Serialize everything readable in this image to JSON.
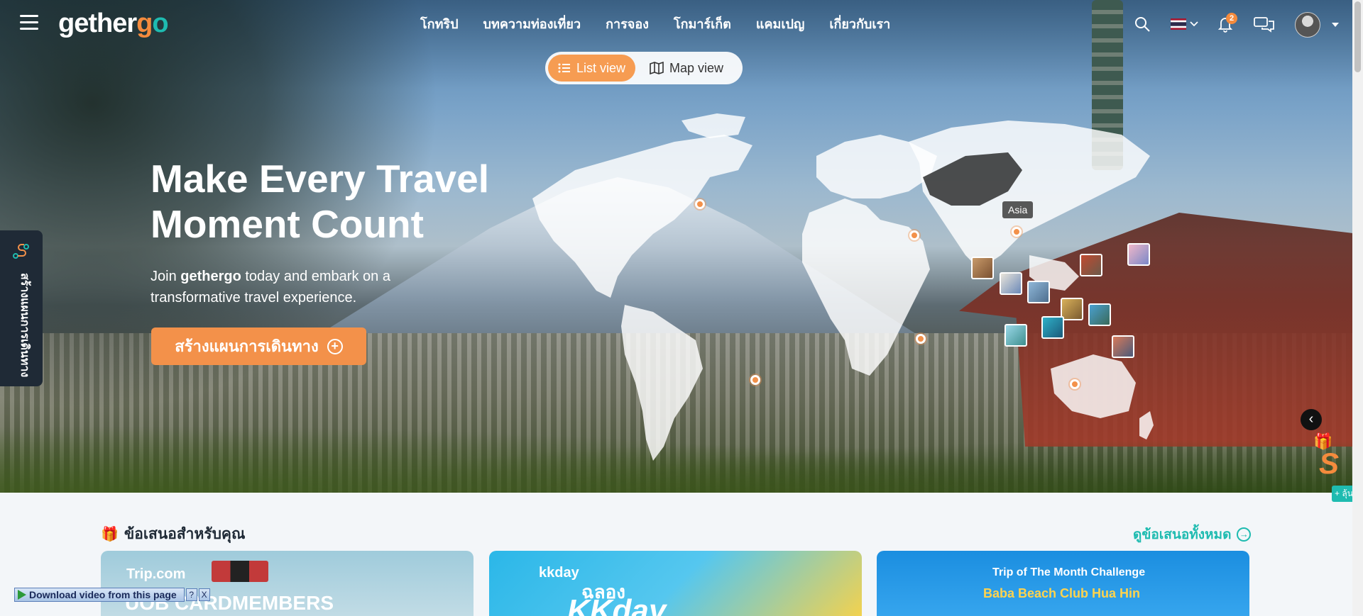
{
  "header": {
    "logo": {
      "part1": "gether",
      "part2": "g",
      "part3": "o"
    },
    "nav": [
      "โกทริป",
      "บทความท่องเที่ยว",
      "การจอง",
      "โกมาร์เก็ต",
      "แคมเปญ",
      "เกี่ยวกับเรา"
    ],
    "notification_count": "2",
    "icons": [
      "menu-icon",
      "search-icon",
      "thai-flag-icon",
      "chevron-down-icon",
      "bell-icon",
      "chat-icon",
      "avatar",
      "caret-down-icon"
    ]
  },
  "view_toggle": {
    "list": "List view",
    "map": "Map view",
    "active": "list"
  },
  "hero": {
    "title": "Make Every Travel Moment Count",
    "subtitle_before": "Join ",
    "subtitle_brand": "gethergo",
    "subtitle_after": " today and embark on a transformative travel experience.",
    "cta_label": "สร้างแผนการเดินทาง"
  },
  "side_tab": {
    "label": "สร้างแผนการเดินทาง"
  },
  "map": {
    "tooltip": "Asia"
  },
  "offers": {
    "title": "ข้อเสนอสำหรับคุณ",
    "see_all": "ดูข้อเสนอทั้งหมด",
    "cards": [
      {
        "brand": "Trip.com",
        "text": "UOB CARDMEMBERS"
      },
      {
        "brand": "kkday",
        "text": "KKday",
        "extra": "ฉลอง"
      },
      {
        "brand": "Trip of The Month Challenge",
        "text": "Baba Beach Club Hua Hin"
      }
    ]
  },
  "download_bar": {
    "label": "Download video from this page",
    "help": "?",
    "close": "X"
  },
  "colors": {
    "accent": "#f3914a",
    "teal": "#1ebbb0",
    "dark": "#1f2a36"
  }
}
